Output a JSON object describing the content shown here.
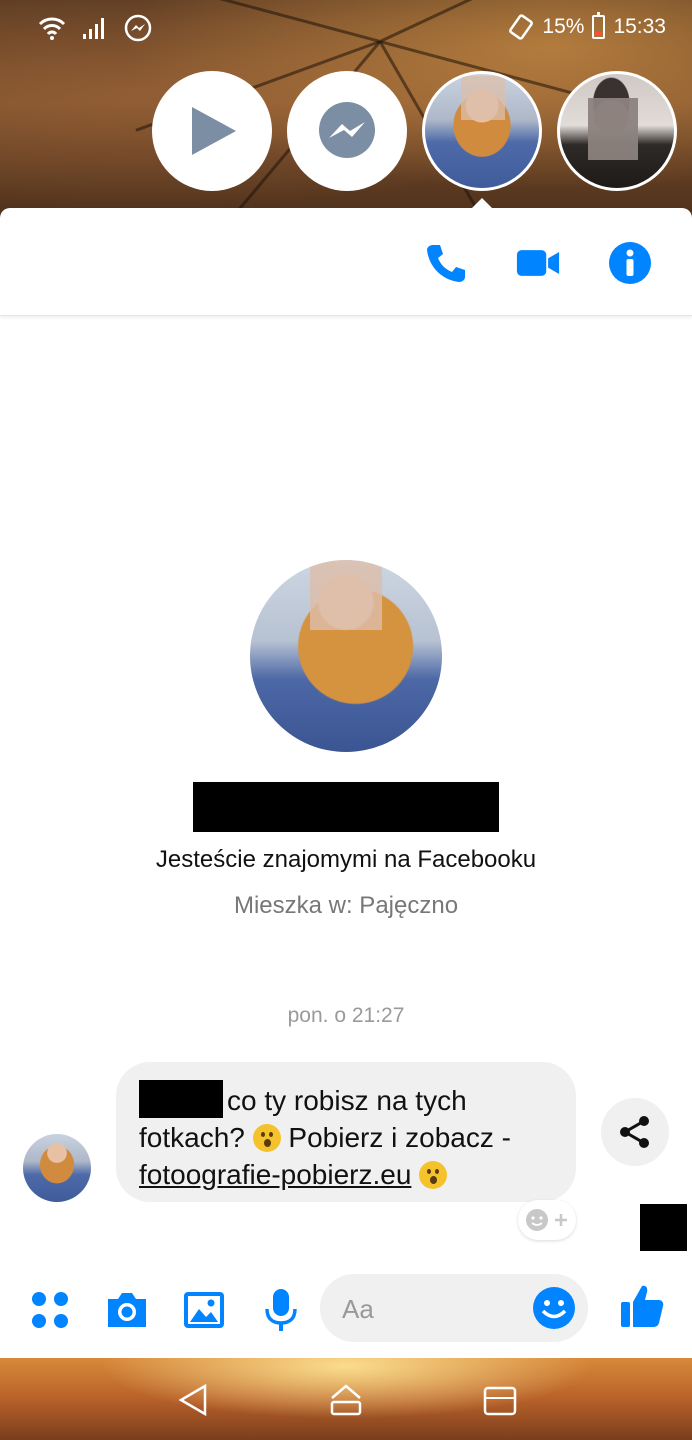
{
  "status_bar": {
    "battery_percent": "15%",
    "time": "15:33"
  },
  "chat_heads": [
    {
      "name": "play-head"
    },
    {
      "name": "messenger-head"
    },
    {
      "name": "contact-head-1"
    },
    {
      "name": "contact-head-2"
    }
  ],
  "profile": {
    "friends_text": "Jesteście znajomymi na Facebooku",
    "lives_text": "Mieszka w: Pajęczno"
  },
  "conversation": {
    "timestamp": "pon. o 21:27",
    "message": {
      "line1": "co ty robisz na tych",
      "line2": "fotkach? ",
      "line2b": " Pobierz i zobacz -",
      "link": "fotoografie-pobierz.eu"
    }
  },
  "composer": {
    "placeholder": "Aa"
  },
  "colors": {
    "accent": "#0084ff",
    "bubble_bg": "#f0f0f0"
  }
}
